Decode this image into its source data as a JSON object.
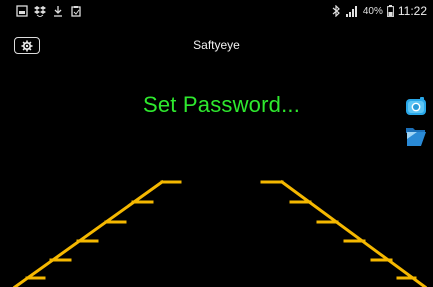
{
  "status_bar": {
    "left_icons": [
      "image-icon",
      "dropbox-icon",
      "download-icon",
      "clipboard-icon"
    ],
    "right_icons": [
      "bluetooth-icon",
      "signal-icon"
    ],
    "battery": "40%",
    "time": "11:22"
  },
  "header": {
    "settings_icon": "gear-icon",
    "title": "Saftyeye"
  },
  "main": {
    "message": "Set Password...",
    "message_color": "#2ee82e"
  },
  "side_controls": {
    "camera_icon": "camera-icon",
    "folder_icon": "folder-icon"
  },
  "guides": {
    "color": "#f5b800"
  }
}
